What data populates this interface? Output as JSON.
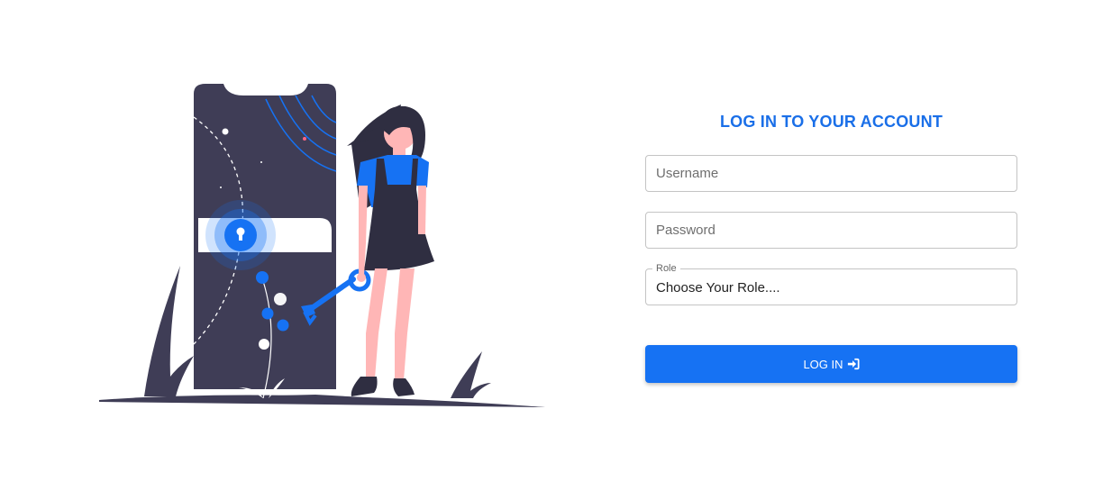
{
  "login": {
    "title": "LOG IN TO YOUR ACCOUNT",
    "username_placeholder": "Username",
    "password_placeholder": "Password",
    "role_label": "Role",
    "role_value": "Choose Your Role....",
    "button_label": "LOG IN",
    "button_icon": "sign-in-icon"
  },
  "colors": {
    "accent": "#1a6fe8",
    "button": "#1672f3",
    "illustration_dark": "#3f3d56",
    "skin": "#ffb6b6"
  }
}
